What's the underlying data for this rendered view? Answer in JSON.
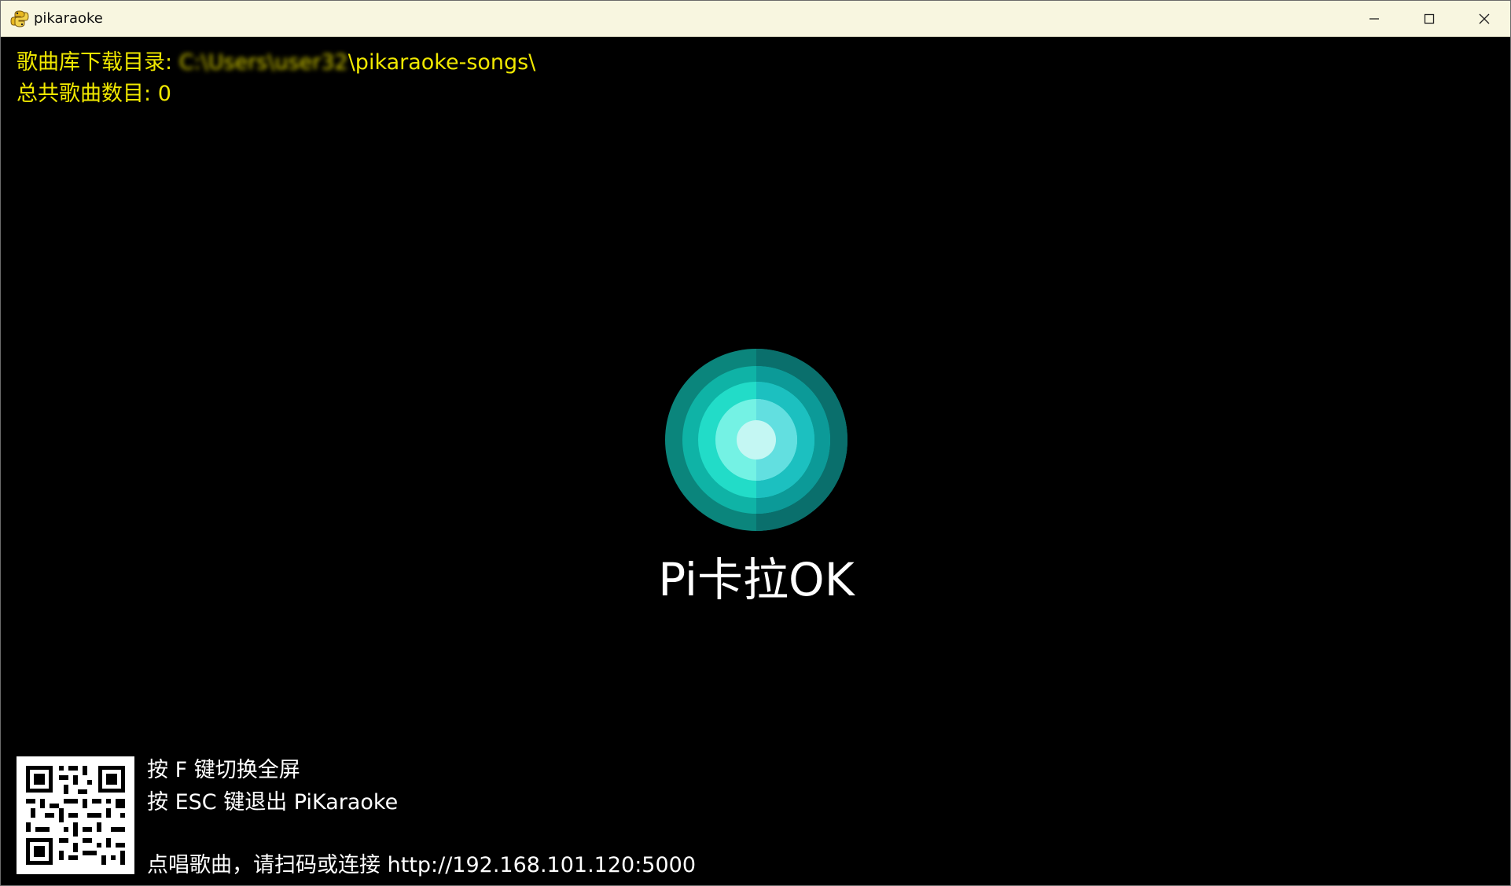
{
  "window": {
    "title": "pikaraoke",
    "app_icon": "python-snake-icon"
  },
  "info": {
    "download_dir_label": "歌曲库下载目录:",
    "download_dir_redacted": "C:\\Users\\user32",
    "download_dir_suffix": "\\pikaraoke-songs\\",
    "total_songs_label": "总共歌曲数目:",
    "total_songs_value": "0"
  },
  "brand": {
    "name": "Pi卡拉OK",
    "logo_colors": [
      "#0b7a73",
      "#0fa89d",
      "#1fd6c4",
      "#6ef0e2",
      "#bff7f0"
    ]
  },
  "help": {
    "fullscreen": "按 F 键切换全屏",
    "exit": "按 ESC 键退出 PiKaraoke",
    "connect_label": "点唱歌曲，请扫码或连接",
    "url": "http://192.168.101.120:5000"
  },
  "colors": {
    "info_text": "#f0e800",
    "help_text": "#ffffff",
    "background": "#000000",
    "titlebar": "#f8f6e0"
  }
}
